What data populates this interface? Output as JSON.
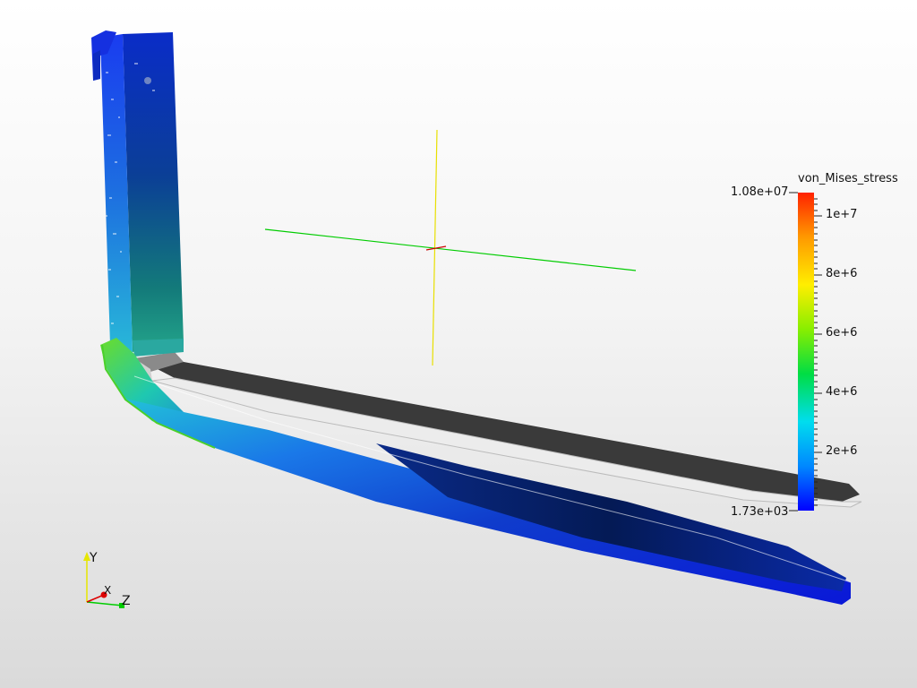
{
  "colorbar": {
    "title": "von_Mises_stress",
    "max_label": "1.08e+07",
    "min_label": "1.73e+03",
    "ticks": [
      {
        "label": "1e+7"
      },
      {
        "label": "8e+6"
      },
      {
        "label": "6e+6"
      },
      {
        "label": "4e+6"
      },
      {
        "label": "2e+6"
      }
    ],
    "colors": [
      "#0000ff",
      "#0088ff",
      "#00ddee",
      "#00dd44",
      "#88ee00",
      "#ffee00",
      "#ff9900",
      "#ff2200"
    ]
  },
  "orientation_axes": {
    "y_label": "Y",
    "x_label": "X",
    "z_label": "Z",
    "y_color": "#e6e600",
    "x_color": "#dd0000",
    "z_color": "#00cc00"
  },
  "crosshair": {
    "vertical_color": "#e8e000",
    "horizontal_color": "#00cc00",
    "center_color": "#cc0000"
  }
}
